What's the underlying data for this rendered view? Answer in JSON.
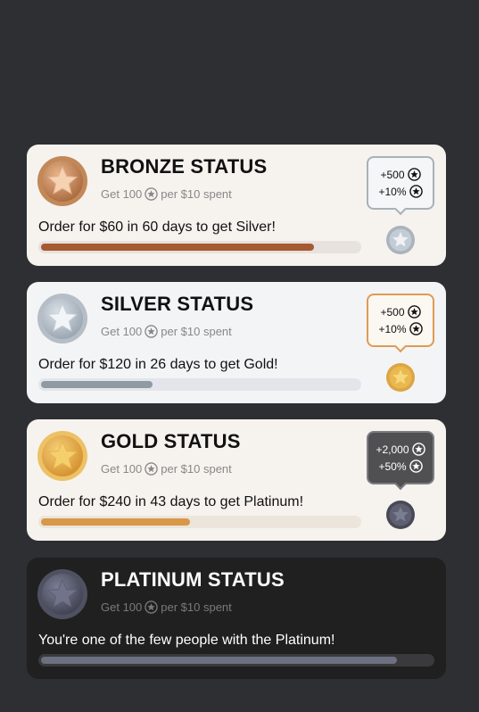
{
  "coin_icon": "star-coin-icon",
  "tiers": [
    {
      "title": "BRONZE STATUS",
      "earn_prefix": "Get 100",
      "earn_suffix": "per $10 spent",
      "goal": "Order for $60 in 60 days to get Silver!",
      "progress": 0.86,
      "next_bonus": [
        "+500",
        "+10%"
      ],
      "medal_color": "#c1865a",
      "next_medal_color": "#a9b3bc"
    },
    {
      "title": "SILVER STATUS",
      "earn_prefix": "Get 100",
      "earn_suffix": "per $10 spent",
      "goal": "Order for $120 in 26 days to get Gold!",
      "progress": 0.35,
      "next_bonus": [
        "+500",
        "+10%"
      ],
      "medal_color": "#aab3bc",
      "next_medal_color": "#dda545"
    },
    {
      "title": "GOLD STATUS",
      "earn_prefix": "Get 100",
      "earn_suffix": "per $10 spent",
      "goal": "Order for $240 in 43 days to get Platinum!",
      "progress": 0.47,
      "next_bonus": [
        "+2,000",
        "+50%"
      ],
      "medal_color": "#e3a83f",
      "next_medal_color": "#5b5d6e"
    },
    {
      "title": "PLATINUM STATUS",
      "earn_prefix": "Get 100",
      "earn_suffix": "per $10 spent",
      "goal": "You're one of the few people with the Platinum!",
      "progress": 0.91,
      "medal_color": "#5c5e6f"
    }
  ]
}
